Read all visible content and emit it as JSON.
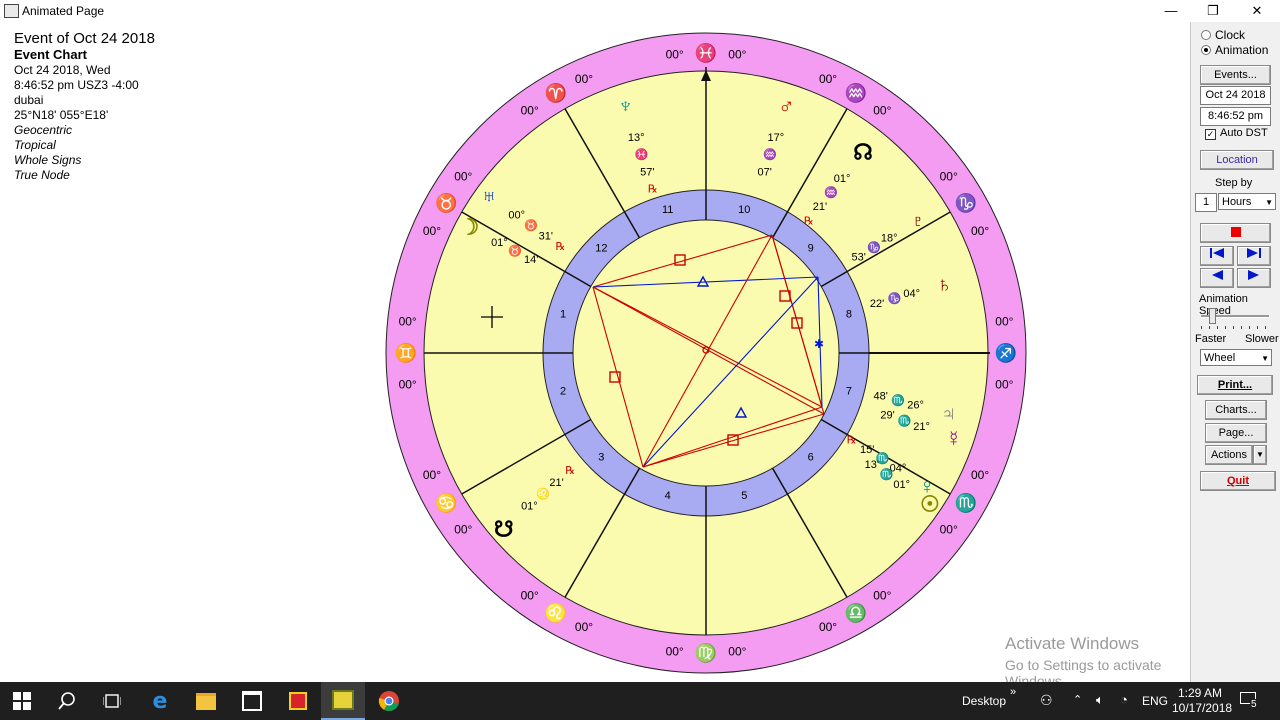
{
  "window": {
    "title": "Animated Page",
    "minimize_glyph": "—",
    "restore_glyph": "❐",
    "close_glyph": "✕"
  },
  "info": {
    "title": "Event of Oct 24 2018",
    "chart_type": "Event Chart",
    "date": "Oct 24 2018, Wed",
    "time": "8:46:52 pm  USZ3 -4:00",
    "place": "dubai",
    "coords": "25°N18' 055°E18'",
    "options": [
      "Geocentric",
      "Tropical",
      "Whole Signs",
      "True Node"
    ]
  },
  "colors": {
    "outer_ring": "#f49bf2",
    "inner_field": "#fbfbb0",
    "house_ring": "#a9abf2",
    "aspect_red": "#cc0000",
    "aspect_blue": "#0018cc"
  },
  "wheel": {
    "sign_cusp_label": "00°",
    "signs": [
      {
        "glyph": "♓",
        "name": "pisces",
        "color": "#0022aa"
      },
      {
        "glyph": "♒",
        "name": "aquarius",
        "color": "#0022aa"
      },
      {
        "glyph": "♑",
        "name": "capricorn",
        "color": "#009900"
      },
      {
        "glyph": "♐",
        "name": "sagittarius",
        "color": "#cc0000"
      },
      {
        "glyph": "♏",
        "name": "scorpio",
        "color": "#0022aa"
      },
      {
        "glyph": "♎",
        "name": "libra",
        "color": "#0022aa"
      },
      {
        "glyph": "♍",
        "name": "virgo",
        "color": "#009900"
      },
      {
        "glyph": "♌",
        "name": "leo",
        "color": "#cc0000"
      },
      {
        "glyph": "♋",
        "name": "cancer",
        "color": "#0022aa"
      },
      {
        "glyph": "♊",
        "name": "gemini",
        "color": "#0022aa"
      },
      {
        "glyph": "♉",
        "name": "taurus",
        "color": "#009900"
      },
      {
        "glyph": "♈",
        "name": "aries",
        "color": "#cc0000"
      }
    ],
    "houses": [
      "10",
      "9",
      "8",
      "7",
      "6",
      "5",
      "4",
      "3",
      "2",
      "1",
      "12",
      "11"
    ],
    "planets": [
      {
        "name": "neptune",
        "glyph": "♆",
        "color": "#009999",
        "deg": "13°",
        "sign": "♓",
        "min": "57'",
        "retro": "℞"
      },
      {
        "name": "mars",
        "glyph": "♂",
        "color": "#cc0000",
        "deg": "17°",
        "sign": "♒",
        "min": "07'",
        "retro": ""
      },
      {
        "name": "north-node",
        "glyph": "☊",
        "color": "#000000",
        "deg": "01°",
        "sign": "♒",
        "min": "21'",
        "retro": "℞"
      },
      {
        "name": "pluto",
        "glyph": "♇",
        "color": "#880000",
        "deg": "18°",
        "sign": "♑",
        "min": "53'",
        "retro": ""
      },
      {
        "name": "saturn",
        "glyph": "♄",
        "color": "#880000",
        "deg": "04°",
        "sign": "♑",
        "min": "22'",
        "retro": ""
      },
      {
        "name": "jupiter",
        "glyph": "♃",
        "color": "#777777",
        "deg": "26°",
        "sign": "♏",
        "min": "48'",
        "retro": ""
      },
      {
        "name": "mercury",
        "glyph": "☿",
        "color": "#880088",
        "deg": "21°",
        "sign": "♏",
        "min": "29'",
        "retro": ""
      },
      {
        "name": "venus",
        "glyph": "♀",
        "color": "#008888",
        "deg": "04°",
        "sign": "♏",
        "min": "15'",
        "retro": "℞"
      },
      {
        "name": "sun",
        "glyph": "☉",
        "color": "#888800",
        "deg": "01°",
        "sign": "♏",
        "min": "13'",
        "retro": ""
      },
      {
        "name": "south-node",
        "glyph": "☋",
        "color": "#000000",
        "deg": "01°",
        "sign": "♌",
        "min": "21'",
        "retro": "℞"
      },
      {
        "name": "moon",
        "glyph": "☽",
        "color": "#888800",
        "deg": "01°",
        "sign": "♉",
        "min": "14'",
        "retro": ""
      },
      {
        "name": "uranus",
        "glyph": "♅",
        "color": "#0033cc",
        "deg": "00°",
        "sign": "♉",
        "min": "31'",
        "retro": "℞"
      }
    ]
  },
  "panel": {
    "radio_clock": "Clock",
    "radio_animation": "Animation",
    "events_btn": "Events...",
    "date_value": "Oct 24 2018",
    "time_value": "8:46:52 pm",
    "auto_dst": "Auto DST",
    "location_btn": "Location",
    "step_by": "Step by",
    "step_value": "1",
    "step_unit": "Hours",
    "anim_speed": "Animation Speed",
    "faster": "Faster",
    "slower": "Slower",
    "wheel_select": "Wheel",
    "print_btn": "Print...",
    "charts_btn": "Charts...",
    "page_btn": "Page...",
    "actions_btn": "Actions",
    "quit_btn": "Quit"
  },
  "watermark": {
    "line1": "Activate Windows",
    "line2": "Go to Settings to activate Windows."
  },
  "taskbar": {
    "desktop": "Desktop",
    "language": "ENG",
    "time": "1:29 AM",
    "date": "10/17/2018",
    "notifications": "5"
  }
}
